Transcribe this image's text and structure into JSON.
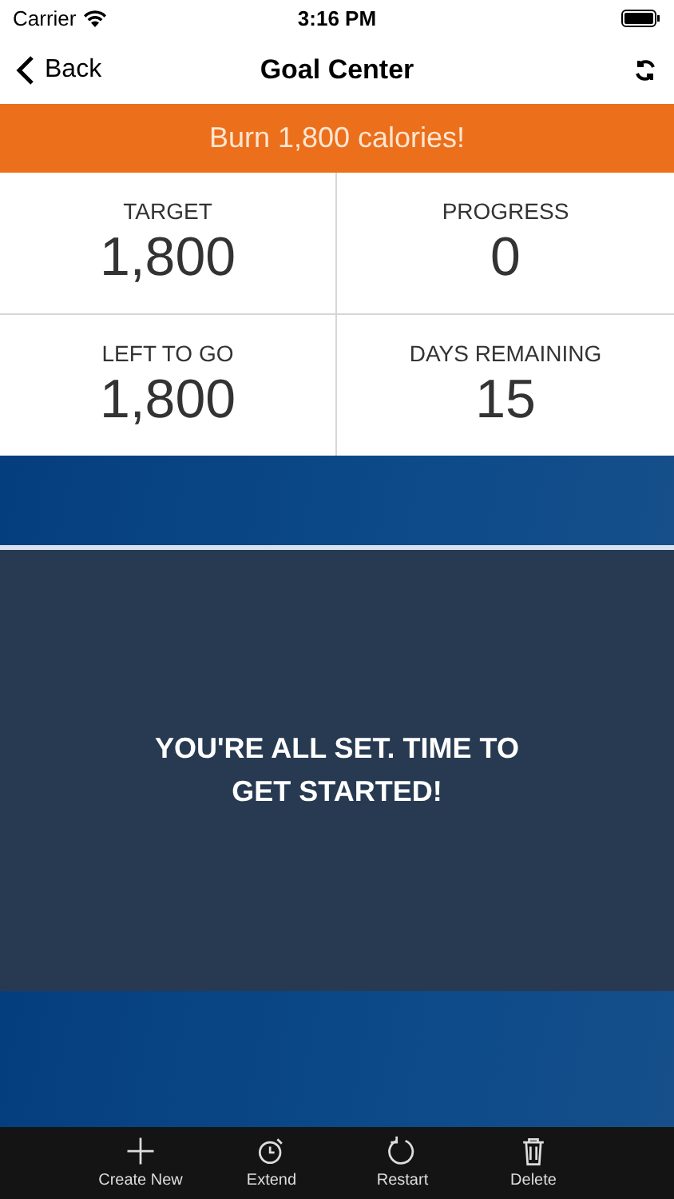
{
  "status_bar": {
    "carrier": "Carrier",
    "time": "3:16 PM"
  },
  "nav": {
    "back": "Back",
    "title": "Goal Center"
  },
  "banner": "Burn 1,800 calories!",
  "stats": [
    {
      "label": "TARGET",
      "value": "1,800"
    },
    {
      "label": "PROGRESS",
      "value": "0"
    },
    {
      "label": "LEFT TO GO",
      "value": "1,800"
    },
    {
      "label": "DAYS REMAINING",
      "value": "15"
    }
  ],
  "message": "YOU'RE ALL SET. TIME TO GET STARTED!",
  "toolbar": [
    {
      "kind": "create",
      "label": "Create New"
    },
    {
      "kind": "extend",
      "label": "Extend"
    },
    {
      "kind": "restart",
      "label": "Restart"
    },
    {
      "kind": "delete",
      "label": "Delete"
    }
  ]
}
